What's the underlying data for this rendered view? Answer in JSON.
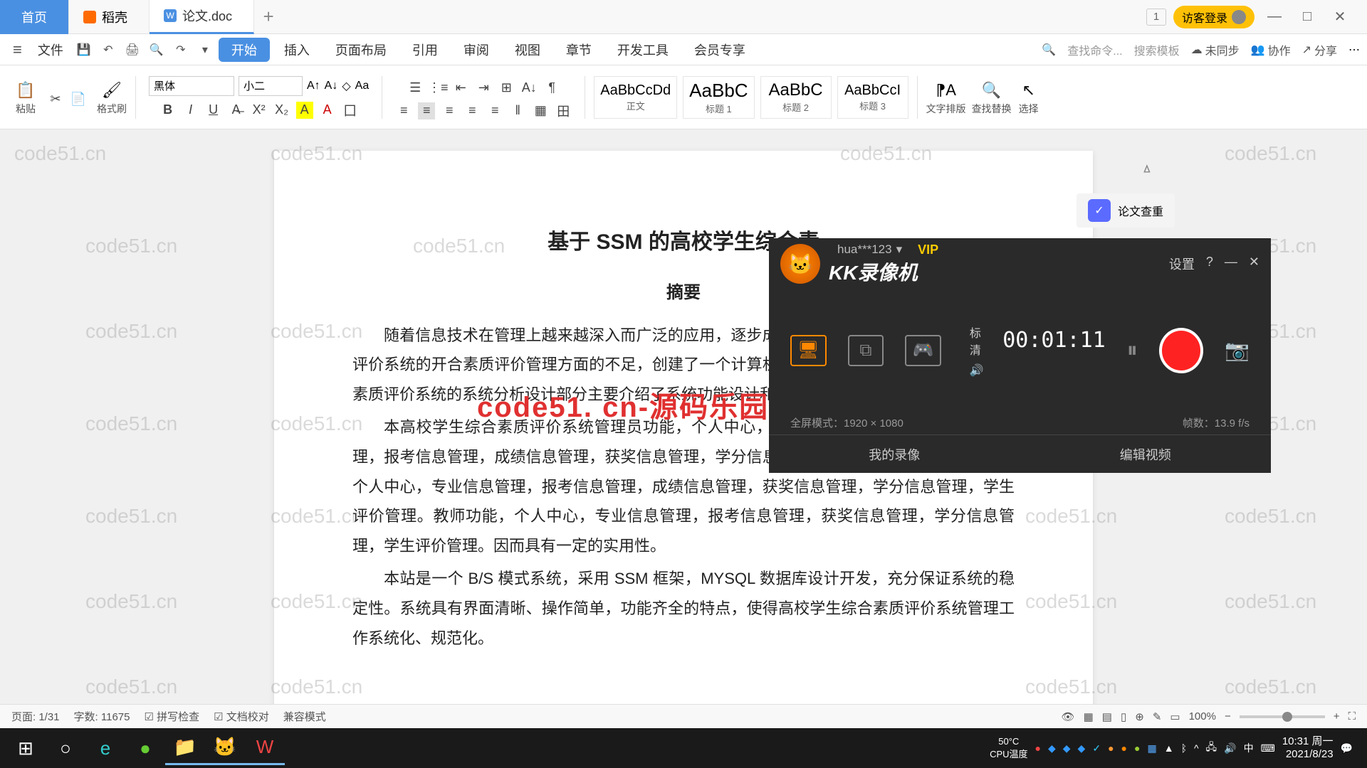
{
  "titlebar": {
    "home": "首页",
    "tab1": "稻壳",
    "tab2": "论文.doc",
    "login": "访客登录",
    "window_index": "1"
  },
  "menubar": {
    "file": "文件",
    "items": [
      "开始",
      "插入",
      "页面布局",
      "引用",
      "审阅",
      "视图",
      "章节",
      "开发工具",
      "会员专享"
    ],
    "search_hint": "查找命令...",
    "search_tmpl": "搜索模板",
    "unsync": "未同步",
    "coop": "协作",
    "share": "分享"
  },
  "ribbon": {
    "paste": "粘贴",
    "format_brush": "格式刷",
    "font_name": "黑体",
    "font_size": "小二",
    "styles": [
      {
        "preview": "AaBbCcDd",
        "name": "正文"
      },
      {
        "preview": "AaBbC",
        "name": "标题 1"
      },
      {
        "preview": "AaBbC",
        "name": "标题 2"
      },
      {
        "preview": "AaBbCcI",
        "name": "标题 3"
      }
    ],
    "text_tools": "文字排版",
    "find_replace": "查找替换",
    "select": "选择"
  },
  "document": {
    "title": "基于 SSM 的高校学生综合素",
    "subtitle": "摘要",
    "p1": "随着信息技术在管理上越来越深入而广泛的应用，逐步成熟。本文介绍了高校学生综合素质评价系统的开合素质评价管理方面的不足，创建了一个计算机管理案。文章介绍了高校学生综合素质评价系统的系统分析设计部分主要介绍了系统功能设计和数据库设计。",
    "p2": "本高校学生综合素质评价系统管理员功能，个人中心，学生管理，教师管理，专业信息管理，报考信息管理，成绩信息管理，获奖信息管理，学分信息管理，学生评价管理。学生功能，个人中心，专业信息管理，报考信息管理，成绩信息管理，获奖信息管理，学分信息管理，学生评价管理。教师功能，个人中心，专业信息管理，报考信息管理，获奖信息管理，学分信息管理，学生评价管理。因而具有一定的实用性。",
    "p3": "本站是一个 B/S 模式系统，采用 SSM 框架，MYSQL 数据库设计开发，充分保证系统的稳定性。系统具有界面清晰、操作简单，功能齐全的特点，使得高校学生综合素质评价系统管理工作系统化、规范化。"
  },
  "side_badge": "论文查重",
  "kk": {
    "title": "KK录像机",
    "user": "hua***123",
    "vip": "VIP",
    "settings": "设置",
    "quality": "标清",
    "time": "00:01:11",
    "mode_info": "全屏模式：1920 × 1080",
    "frame_info": "帧数：13.9 f/s",
    "my_record": "我的录像",
    "edit_video": "编辑视频"
  },
  "statusbar": {
    "page": "页面: 1/31",
    "words": "字数: 11675",
    "spell": "拼写检查",
    "doc_check": "文档校对",
    "compat": "兼容模式",
    "zoom": "100%"
  },
  "taskbar": {
    "temp": "50°C",
    "cpu": "CPU温度",
    "time": "10:31",
    "period": "周一",
    "date": "2021/8/23"
  },
  "watermark": {
    "text": "code51.cn",
    "center": "code51. cn-源码乐园盗图必究"
  }
}
